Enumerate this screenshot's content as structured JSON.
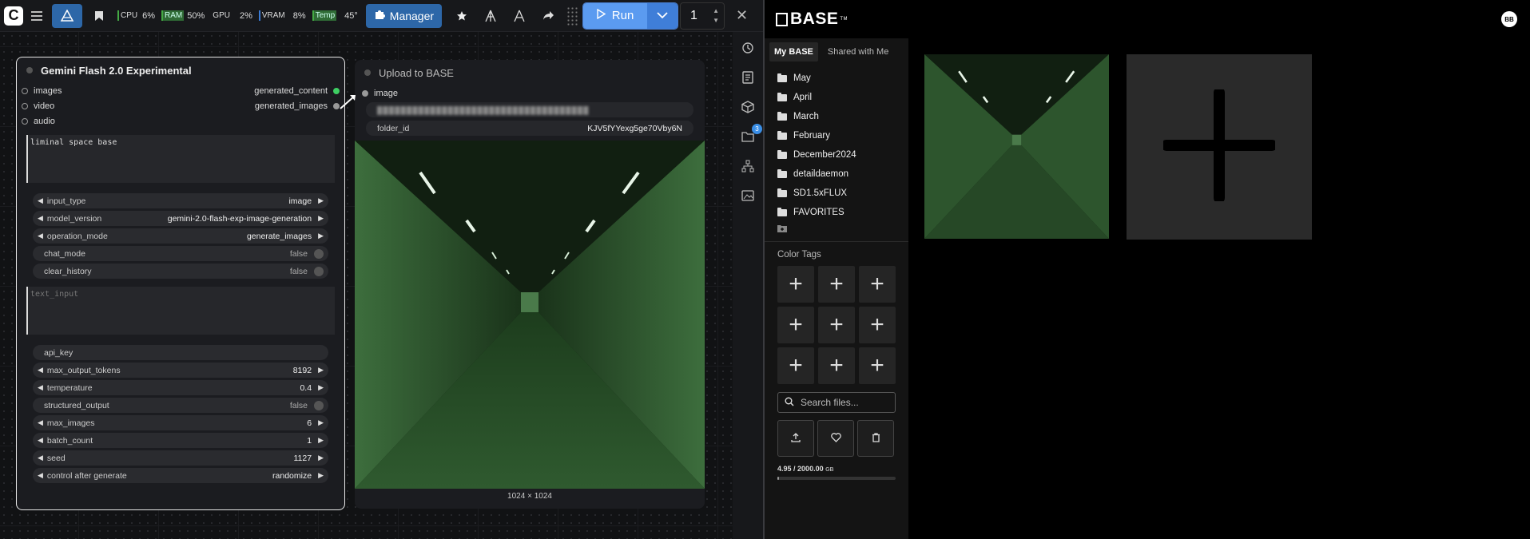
{
  "toolbar": {
    "cpu_label": "CPU",
    "cpu_value": "6%",
    "ram_label": "RAM",
    "ram_value": "50%",
    "gpu_label": "GPU",
    "gpu_value": "2%",
    "vram_label": "VRAM",
    "vram_value": "8%",
    "temp_label": "Temp",
    "temp_value": "45°",
    "manager_label": "Manager",
    "run_label": "Run",
    "run_count": "1",
    "icons": [
      "logo-icon",
      "menu-icon",
      "workflow-icon",
      "bookmark-icon",
      "puzzle-icon",
      "star-icon",
      "model-icon",
      "model-alt-icon",
      "share-icon",
      "drag-handle-icon",
      "play-icon",
      "chevron-down-icon",
      "close-icon"
    ]
  },
  "gemini_node": {
    "title": "Gemini Flash 2.0 Experimental",
    "inputs": [
      "images",
      "video",
      "audio"
    ],
    "outputs": [
      "generated_content",
      "generated_images"
    ],
    "prompt": "liminal space base",
    "widgets_a": [
      {
        "name": "input_type",
        "value": "image",
        "kind": "combo"
      },
      {
        "name": "model_version",
        "value": "gemini-2.0-flash-exp-image-generation",
        "kind": "combo"
      },
      {
        "name": "operation_mode",
        "value": "generate_images",
        "kind": "combo"
      },
      {
        "name": "chat_mode",
        "value": "false",
        "kind": "toggle"
      },
      {
        "name": "clear_history",
        "value": "false",
        "kind": "toggle"
      }
    ],
    "text_input_placeholder": "text_input",
    "api_key_label": "api_key",
    "widgets_b": [
      {
        "name": "max_output_tokens",
        "value": "8192",
        "kind": "number"
      },
      {
        "name": "temperature",
        "value": "0.4",
        "kind": "number"
      },
      {
        "name": "structured_output",
        "value": "false",
        "kind": "toggle"
      },
      {
        "name": "max_images",
        "value": "6",
        "kind": "number"
      },
      {
        "name": "batch_count",
        "value": "1",
        "kind": "number"
      },
      {
        "name": "seed",
        "value": "1127",
        "kind": "number"
      },
      {
        "name": "control after generate",
        "value": "randomize",
        "kind": "combo"
      }
    ]
  },
  "upload_node": {
    "title": "Upload to BASE",
    "input": "image",
    "field_1_value": "████████████████████████████████████",
    "folder_label": "folder_id",
    "folder_value": "KJV5fYYexg5ge70Vby6N",
    "image_size": "1024 × 1024"
  },
  "sidestrip": {
    "icons": [
      "history-icon",
      "notes-icon",
      "cube-icon",
      "queue-folder-icon",
      "hierarchy-icon",
      "gallery-icon"
    ],
    "badge": "3"
  },
  "base": {
    "logo": "BASE",
    "avatar": "BB",
    "tabs": [
      "My BASE",
      "Shared with Me"
    ],
    "folders": [
      "May",
      "April",
      "March",
      "February",
      "December2024",
      "detaildaemon",
      "SD1.5xFLUX",
      "FAVORITES"
    ],
    "color_tags_label": "Color Tags",
    "search_placeholder": "Search files...",
    "storage_used": "4.95",
    "storage_total": "/ 2000.00",
    "storage_unit": "GB",
    "storage_fraction": 0.0025
  }
}
